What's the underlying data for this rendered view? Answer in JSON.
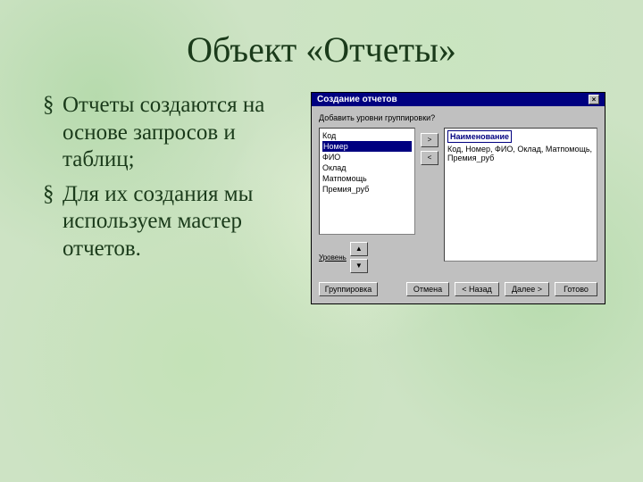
{
  "title": "Объект «Отчеты»",
  "bullets": [
    "Отчеты создаются на основе запросов и таблиц;",
    "Для их создания мы используем мастер отчетов."
  ],
  "bullet_mark": "§",
  "dialog": {
    "titlebar": "Создание отчетов",
    "close": "×",
    "prompt": "Добавить уровни группировки?",
    "left_list": [
      "Код",
      "Номер",
      "ФИО",
      "Оклад",
      "Матпомощь",
      "Премия_руб"
    ],
    "selected_index": 1,
    "right_header": "Наименование",
    "right_line": "Код, Номер, ФИО, Оклад, Матпомощь, Премия_руб",
    "btn_add": ">",
    "btn_remove": "<",
    "btn_up": "▲",
    "btn_down": "▼",
    "tier_label": "Уровень",
    "footer": {
      "grouping": "Группировка",
      "cancel": "Отмена",
      "back": "< Назад",
      "next": "Далее >",
      "finish": "Готово"
    }
  }
}
